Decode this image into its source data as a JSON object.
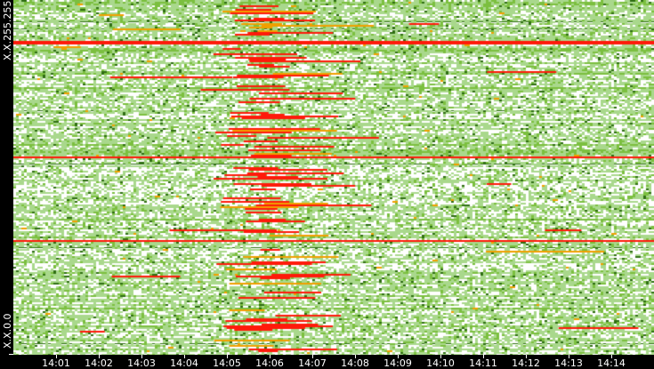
{
  "chart_data": {
    "type": "heatmap",
    "title": "",
    "xlabel": "",
    "ylabel": "",
    "y_tick_labels": [
      "X.X.255.255",
      "X.X.0.0"
    ],
    "x_tick_labels": [
      "14:01",
      "14:02",
      "14:03",
      "14:04",
      "14:05",
      "14:06",
      "14:07",
      "14:08",
      "14:09",
      "14:10",
      "14:11",
      "14:12",
      "14:13",
      "14:14"
    ],
    "x_range": [
      "14:00",
      "14:15"
    ],
    "hotspot_window": [
      "14:05",
      "14:08"
    ],
    "colors": {
      "empty": "#ffffff",
      "low": "#a9d88c",
      "mid": "#7bbf3f",
      "dark": "#2f6e12",
      "warn": "#f0a000",
      "high": "#ff1a0a"
    }
  }
}
